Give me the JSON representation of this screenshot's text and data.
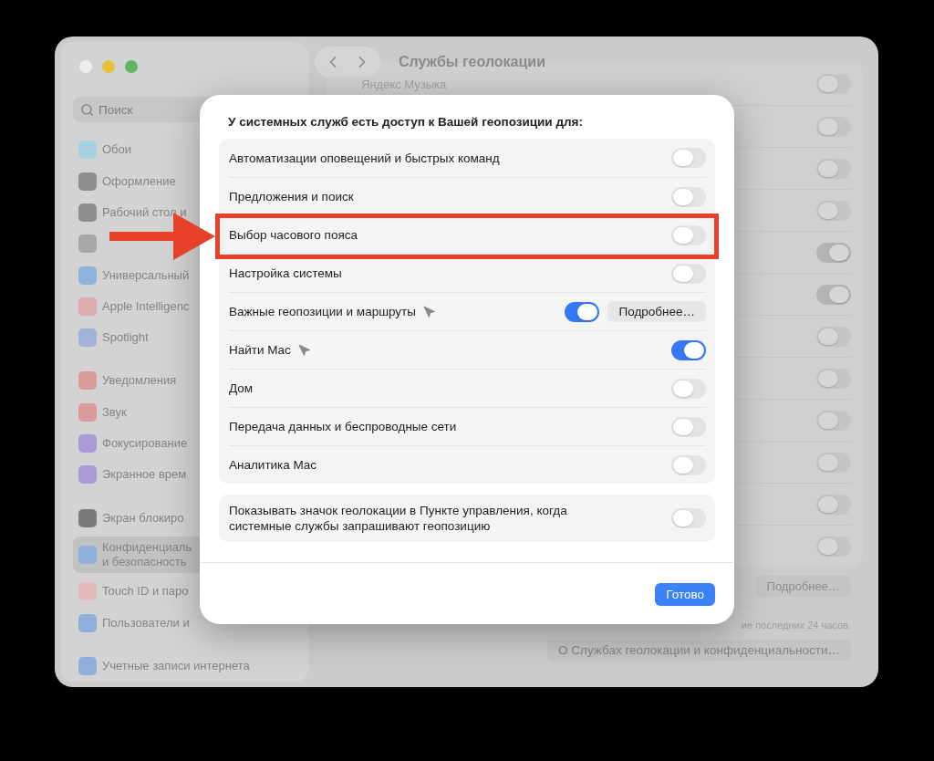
{
  "window": {
    "title": "Службы геолокации"
  },
  "sidebar": {
    "search": {
      "placeholder": "Поиск"
    },
    "groups": [
      [
        {
          "label": "Обои",
          "selected": false,
          "color": "#a9cfe0"
        },
        {
          "label": "Оформление",
          "selected": false,
          "color": "#8e8e8e"
        },
        {
          "label": "Рабочий стол и",
          "selected": false,
          "color": "#8e8e8e"
        },
        {
          "selected": false,
          "color": "#a8a8a8"
        },
        {
          "label": "Универсальный",
          "selected": false,
          "color": "#8fb3dc"
        },
        {
          "label": "Apple Intelligenc",
          "selected": false,
          "color": "#dcaab0"
        },
        {
          "label": "Spotlight",
          "selected": false,
          "color": "#9fb2d8"
        }
      ],
      [
        {
          "label": "Уведомления",
          "selected": false,
          "color": "#d99a9a"
        },
        {
          "label": "Звук",
          "selected": false,
          "color": "#d99a9a"
        },
        {
          "label": "Фокусирование",
          "selected": false,
          "color": "#aa9ad6"
        },
        {
          "label": "Экранное врем",
          "selected": false,
          "color": "#aa9ad6"
        }
      ],
      [
        {
          "label": "Экран блокиро",
          "selected": false,
          "color": "#7a7a7a"
        },
        {
          "label": "Конфиденциаль\nи безопасность",
          "selected": true,
          "color": "#8fb0dc"
        },
        {
          "label": "Touch ID и паро",
          "selected": false,
          "color": "#e4b9b9"
        },
        {
          "label": "Пользователи и",
          "selected": false,
          "color": "#8fb0dc"
        }
      ],
      [
        {
          "label": "Учетные записи интернета",
          "selected": false,
          "color": "#8fb0dc"
        }
      ]
    ]
  },
  "content": {
    "rows": [
      {
        "label": "Яндекс Музыка",
        "on": false
      },
      {
        "on": false
      },
      {
        "on": false
      },
      {
        "on": false
      },
      {
        "on": true
      },
      {
        "on": true
      },
      {
        "on": false
      },
      {
        "on": false
      },
      {
        "on": false
      },
      {
        "on": false
      },
      {
        "on": false
      },
      {
        "on": false
      }
    ],
    "details_button": "Подробнее…",
    "note": "ие последних 24 часов.",
    "about_button": "О Службах геолокации и конфиденциальности…"
  },
  "dialog": {
    "heading": "У системных служб есть доступ к Вашей геопозиции для:",
    "services": [
      {
        "label": "Автоматизации оповещений и быстрых команд",
        "on": false,
        "location_icon": false,
        "highlighted": false
      },
      {
        "label": "Предложения и поиск",
        "on": false,
        "location_icon": false,
        "highlighted": false
      },
      {
        "label": "Выбор часового пояса",
        "on": false,
        "location_icon": false,
        "highlighted": true
      },
      {
        "label": "Настройка системы",
        "on": false,
        "location_icon": false,
        "highlighted": false
      },
      {
        "label": "Важные геопозиции и маршруты",
        "on": true,
        "location_icon": true,
        "highlighted": false,
        "details_button": "Подробнее…"
      },
      {
        "label": "Найти Mac",
        "on": true,
        "location_icon": true,
        "highlighted": false
      },
      {
        "label": "Дом",
        "on": false,
        "location_icon": false,
        "highlighted": false
      },
      {
        "label": "Передача данных и беспроводные сети",
        "on": false,
        "location_icon": false,
        "highlighted": false
      },
      {
        "label": "Аналитика Mac",
        "on": false,
        "location_icon": false,
        "highlighted": false
      }
    ],
    "status_option": {
      "label": "Показывать значок геолокации в Пункте управления, когда системные службы запрашивают геопозицию",
      "on": false
    },
    "done_button": "Готово"
  }
}
